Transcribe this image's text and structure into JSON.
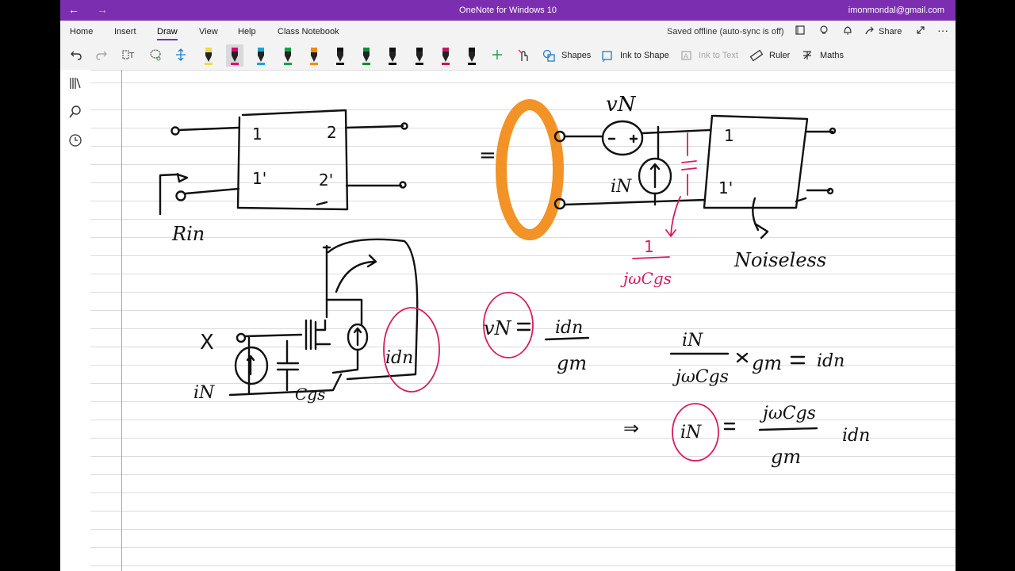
{
  "titlebar": {
    "back": "←",
    "forward": "→",
    "title": "OneNote for Windows 10",
    "user": "imonmondal@gmail.com"
  },
  "ribbon": {
    "tabs": [
      {
        "label": "Home"
      },
      {
        "label": "Insert"
      },
      {
        "label": "Draw"
      },
      {
        "label": "View"
      },
      {
        "label": "Help"
      },
      {
        "label": "Class Notebook"
      }
    ],
    "active_tab": "Draw",
    "status": "Saved offline (auto-sync is off)",
    "share_label": "Share",
    "more": "···"
  },
  "toolbar": {
    "shapes_label": "Shapes",
    "ink_to_shape_label": "Ink to Shape",
    "ink_to_text_label": "Ink to Text",
    "ruler_label": "Ruler",
    "maths_label": "Maths",
    "pens": [
      {
        "color": "#f2d84b",
        "kind": "highlighter"
      },
      {
        "color": "#e0007a",
        "kind": "pen",
        "selected": true
      },
      {
        "color": "#1aa3d9",
        "kind": "pen"
      },
      {
        "color": "#14a34a",
        "kind": "pen"
      },
      {
        "color": "#f28c00",
        "kind": "highlighter"
      },
      {
        "color": "#111111",
        "kind": "pen"
      },
      {
        "color": "#0f8c3c",
        "kind": "pen"
      },
      {
        "color": "#111111",
        "kind": "pen"
      },
      {
        "color": "#111111",
        "kind": "pen"
      },
      {
        "color": "#c2185b",
        "kind": "pen"
      },
      {
        "color": "#111111",
        "kind": "pen"
      }
    ]
  },
  "colors": {
    "accent": "#7b2fb0",
    "ink_black": "#111111",
    "ink_pink": "#d81b60",
    "ink_orange": "#f28c1a"
  },
  "ink": {
    "num_1": "1",
    "num_2": "2",
    "num_1p": "1'",
    "num_2p": "2'",
    "rin": "Rin",
    "equals": "=",
    "vn": "vN",
    "in_label": "iN",
    "noiseless": "Noiseless",
    "one_over": "1",
    "jwcgs": "jωCgs",
    "cross": "X",
    "in_label2": "iN",
    "cgs": "Cgs",
    "idn": "idn",
    "vn2": "vN",
    "eq_idn": "idn",
    "eq_gm": "gm",
    "eq_in": "iN",
    "eq_jwcgs": "jωCgs",
    "eq_times_gm": "gm",
    "eq_idn2": "idn",
    "implies": "⇒",
    "eq_in2": "iN",
    "eq_jwcgs2": "jωCgs",
    "eq_gm2": "gm",
    "eq_idn3": "idn"
  }
}
